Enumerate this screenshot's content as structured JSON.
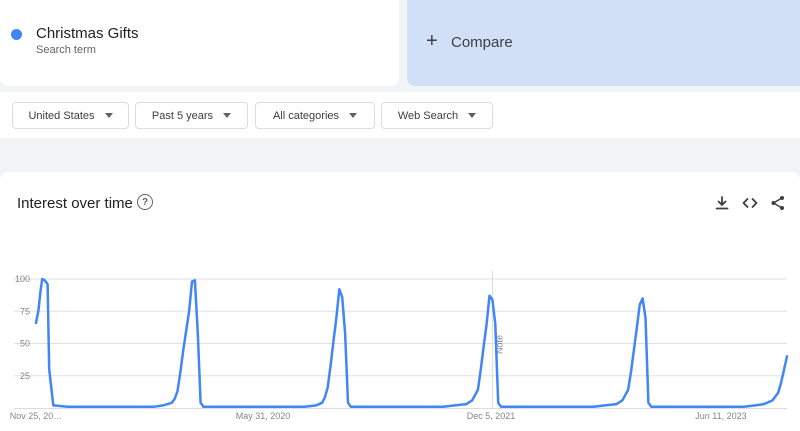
{
  "search_term": {
    "title": "Christmas Gifts",
    "subtitle": "Search term",
    "color": "#4285f4"
  },
  "compare": {
    "plus": "+",
    "label": "Compare"
  },
  "filters": [
    {
      "label": "United States"
    },
    {
      "label": "Past 5 years"
    },
    {
      "label": "All categories"
    },
    {
      "label": "Web Search"
    }
  ],
  "card": {
    "title": "Interest over time",
    "help_icon": "?",
    "actions": [
      {
        "name": "download-icon"
      },
      {
        "name": "embed-icon"
      },
      {
        "name": "share-icon"
      }
    ]
  },
  "chart_data": {
    "type": "line",
    "series": [
      {
        "color": "#4285f4",
        "x": [
          "2018-11-25",
          "2018-12-01",
          "2018-12-05",
          "2018-12-10",
          "2018-12-16",
          "2018-12-23",
          "2018-12-27",
          "2019-01-06",
          "2019-02-10",
          "2019-03-10",
          "2019-04-14",
          "2019-05-12",
          "2019-06-16",
          "2019-07-14",
          "2019-08-11",
          "2019-09-08",
          "2019-09-29",
          "2019-10-20",
          "2019-10-27",
          "2019-11-03",
          "2019-11-10",
          "2019-11-17",
          "2019-11-24",
          "2019-12-01",
          "2019-12-08",
          "2019-12-15",
          "2019-12-22",
          "2019-12-29",
          "2020-01-05",
          "2020-02-09",
          "2020-03-08",
          "2020-04-12",
          "2020-05-10",
          "2020-06-14",
          "2020-07-12",
          "2020-08-09",
          "2020-09-06",
          "2020-10-04",
          "2020-10-18",
          "2020-10-25",
          "2020-11-01",
          "2020-11-08",
          "2020-11-15",
          "2020-11-22",
          "2020-11-29",
          "2020-12-06",
          "2020-12-13",
          "2020-12-20",
          "2020-12-27",
          "2021-01-03",
          "2021-02-07",
          "2021-03-07",
          "2021-04-11",
          "2021-05-09",
          "2021-06-13",
          "2021-07-11",
          "2021-08-08",
          "2021-09-05",
          "2021-10-03",
          "2021-10-17",
          "2021-10-31",
          "2021-11-07",
          "2021-11-14",
          "2021-11-21",
          "2021-11-28",
          "2021-12-05",
          "2021-12-12",
          "2021-12-19",
          "2021-12-26",
          "2022-01-02",
          "2022-02-06",
          "2022-03-06",
          "2022-04-10",
          "2022-05-08",
          "2022-06-12",
          "2022-07-10",
          "2022-08-07",
          "2022-09-04",
          "2022-10-02",
          "2022-10-16",
          "2022-10-30",
          "2022-11-06",
          "2022-11-13",
          "2022-11-20",
          "2022-11-27",
          "2022-12-04",
          "2022-12-11",
          "2022-12-18",
          "2022-12-25",
          "2023-01-01",
          "2023-02-05",
          "2023-03-05",
          "2023-04-09",
          "2023-05-07",
          "2023-06-11",
          "2023-07-09",
          "2023-08-06",
          "2023-09-03",
          "2023-09-24",
          "2023-10-15",
          "2023-10-29",
          "2023-11-05",
          "2023-11-12",
          "2023-11-19"
        ],
        "values": [
          66,
          76,
          88,
          100,
          99,
          96,
          30,
          2,
          1,
          1,
          1,
          1,
          1,
          1,
          1,
          1,
          2,
          4,
          7,
          13,
          28,
          45,
          60,
          75,
          98,
          99,
          58,
          4,
          1,
          1,
          1,
          1,
          1,
          1,
          1,
          1,
          1,
          2,
          4,
          8,
          16,
          33,
          52,
          70,
          92,
          86,
          58,
          4,
          1,
          1,
          1,
          1,
          1,
          1,
          1,
          1,
          1,
          2,
          3,
          6,
          14,
          30,
          48,
          65,
          87,
          84,
          65,
          4,
          1,
          1,
          1,
          1,
          1,
          1,
          1,
          1,
          1,
          2,
          3,
          6,
          14,
          28,
          45,
          62,
          80,
          85,
          70,
          4,
          1,
          1,
          1,
          1,
          1,
          1,
          1,
          1,
          1,
          2,
          3,
          6,
          12,
          20,
          30,
          40
        ]
      }
    ],
    "x_ticks": [
      "Nov 25, 20…",
      "May 31, 2020",
      "Dec 5, 2021",
      "Jun 11, 2023"
    ],
    "y_ticks": [
      100,
      75,
      50,
      25
    ],
    "ylim": [
      0,
      100
    ],
    "grid": true,
    "annotation": {
      "date": "2021-12-05",
      "label": "Note"
    }
  }
}
